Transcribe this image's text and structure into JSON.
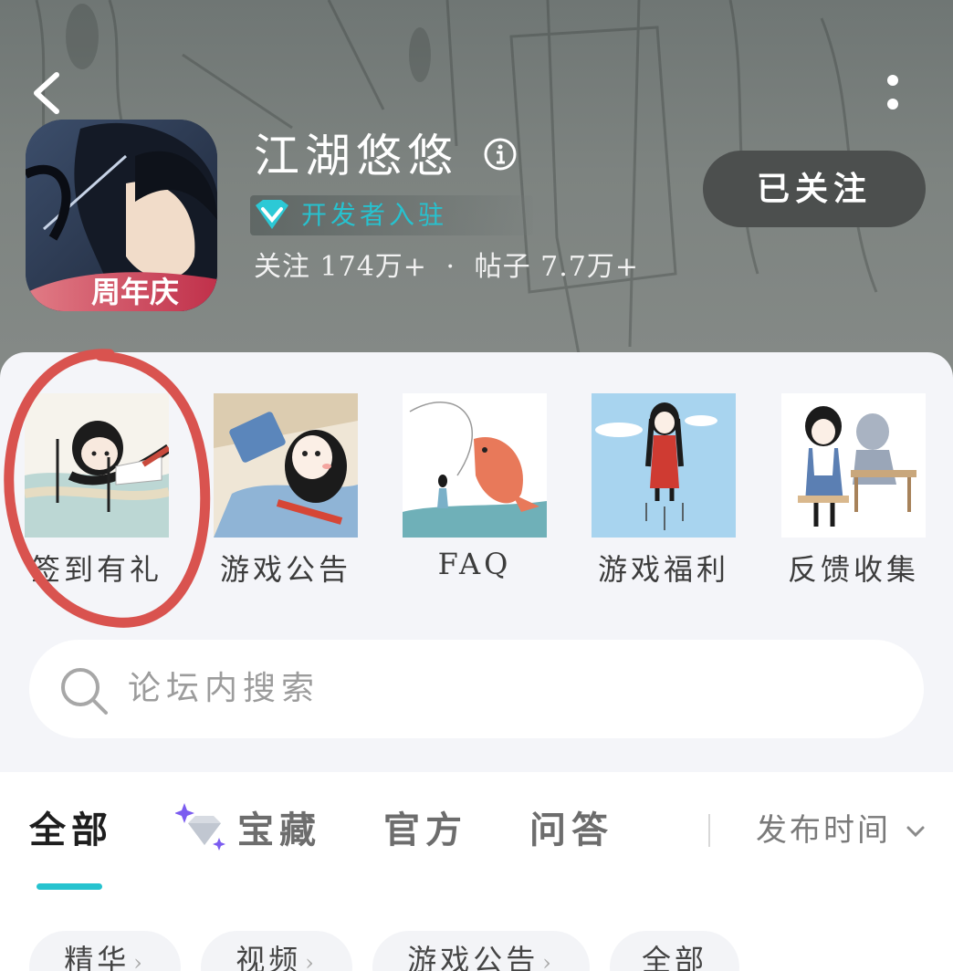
{
  "header": {
    "title": "江湖悠悠",
    "developer_badge": "开发者入驻",
    "stats": {
      "followers_label": "关注",
      "followers_value": "174万+",
      "separator": "·",
      "posts_label": "帖子",
      "posts_value": "7.7万+"
    },
    "follow_button": "已关注",
    "icon_badge": "周年庆"
  },
  "shortcuts": [
    {
      "label": "签到有礼",
      "highlighted": true
    },
    {
      "label": "游戏公告",
      "highlighted": false
    },
    {
      "label": "FAQ",
      "highlighted": false
    },
    {
      "label": "游戏福利",
      "highlighted": false
    },
    {
      "label": "反馈收集",
      "highlighted": false
    }
  ],
  "search": {
    "placeholder": "论坛内搜索"
  },
  "tabs": [
    {
      "label": "全部",
      "active": true
    },
    {
      "label": "宝藏",
      "active": false
    },
    {
      "label": "官方",
      "active": false
    },
    {
      "label": "问答",
      "active": false
    }
  ],
  "sort": {
    "label": "发布时间"
  },
  "filter_chips": [
    {
      "label": "精华"
    },
    {
      "label": "视频"
    },
    {
      "label": "游戏公告"
    },
    {
      "label": "全部"
    }
  ],
  "colors": {
    "accent": "#26c3cf",
    "annotation_circle": "#d9534f",
    "follow_button_bg": "#4c4f4e"
  },
  "icons": {
    "back": "chevron-left-icon",
    "more": "more-vertical-icon",
    "info": "info-icon",
    "developer": "diamond-icon",
    "search": "search-icon",
    "treasure": "sparkle-diamond-icon",
    "sort": "chevron-down-icon"
  }
}
